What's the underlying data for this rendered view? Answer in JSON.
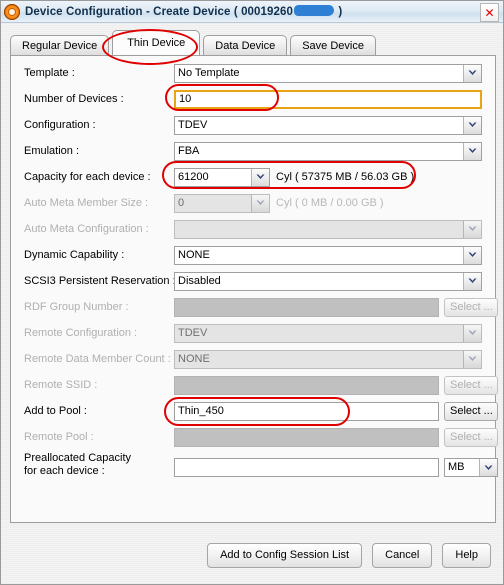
{
  "window": {
    "title_prefix": "Device Configuration - Create Device ( 00019260",
    "title_suffix": " )",
    "icon": "app-donut-icon",
    "close_label": "✕"
  },
  "tabs": [
    {
      "label": "Regular Device",
      "selected": false
    },
    {
      "label": "Thin Device",
      "selected": true
    },
    {
      "label": "Data Device",
      "selected": false
    },
    {
      "label": "Save Device",
      "selected": false
    }
  ],
  "form": {
    "rows": [
      {
        "label": "Template :",
        "value": "No Template",
        "type": "combo",
        "enabled": true
      },
      {
        "label": "Number of Devices :",
        "value": "10",
        "type": "text",
        "enabled": true,
        "highlight": true
      },
      {
        "label": "Configuration :",
        "value": "TDEV",
        "type": "combo",
        "enabled": true
      },
      {
        "label": "Emulation :",
        "value": "FBA",
        "type": "combo",
        "enabled": true
      },
      {
        "label": "Capacity for each device :",
        "value": "61200",
        "type": "combo-short",
        "enabled": true,
        "unit": "Cyl  ( 57375 MB / 56.03 GB )"
      },
      {
        "label": "Auto Meta Member Size :",
        "value": "0",
        "type": "combo-short",
        "enabled": false,
        "unit": "Cyl  ( 0 MB / 0.00 GB )"
      },
      {
        "label": "Auto Meta Configuration :",
        "value": "",
        "type": "combo",
        "enabled": false
      },
      {
        "label": "Dynamic Capability :",
        "value": "NONE",
        "type": "combo",
        "enabled": true
      },
      {
        "label": "SCSI3 Persistent Reservation :",
        "value": "Disabled",
        "type": "combo",
        "enabled": true
      },
      {
        "label": "RDF Group Number :",
        "value": "",
        "type": "text-select",
        "enabled": false,
        "button": "Select ..."
      },
      {
        "label": "Remote Configuration :",
        "value": "TDEV",
        "type": "combo",
        "enabled": false
      },
      {
        "label": "Remote Data Member Count :",
        "value": "NONE",
        "type": "combo",
        "enabled": false
      },
      {
        "label": "Remote SSID :",
        "value": "",
        "type": "text-select",
        "enabled": false,
        "button": "Select ..."
      },
      {
        "label": "Add to Pool :",
        "value": "Thin_450",
        "type": "text-select",
        "enabled": true,
        "button": "Select ..."
      },
      {
        "label": "Remote Pool :",
        "value": "",
        "type": "text-select",
        "enabled": false,
        "button": "Select ..."
      },
      {
        "label_line1": "Preallocated Capacity",
        "label_line2": "for each device :",
        "value": "",
        "type": "text-unit-combo",
        "enabled": true,
        "unit_value": "MB"
      }
    ]
  },
  "footer": {
    "primary": "Add to Config Session List",
    "cancel": "Cancel",
    "help": "Help"
  },
  "colors": {
    "highlight_border": "#e8a317",
    "annotation": "#e00000",
    "title_text": "#11304d",
    "redaction": "#2f7fd4"
  }
}
